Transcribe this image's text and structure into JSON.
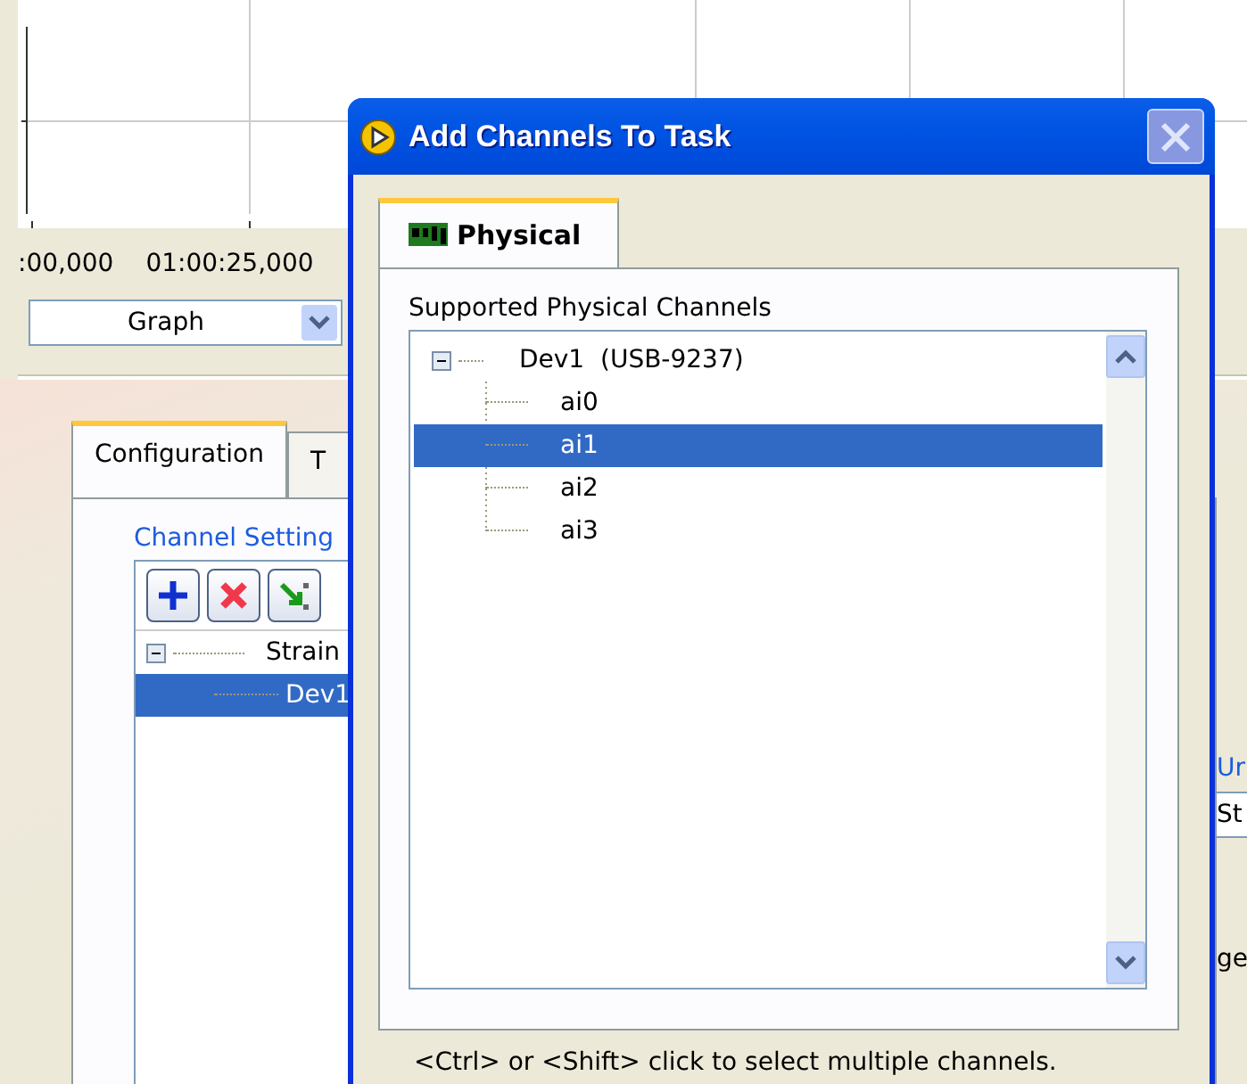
{
  "graph": {
    "x_tick_labels": [
      ":00,000",
      "01:00:25,000"
    ],
    "view_select": {
      "value": "Graph"
    }
  },
  "config_panel": {
    "tabs": [
      {
        "label": "Configuration",
        "selected": true
      },
      {
        "label": "T",
        "selected": false
      }
    ],
    "group_title": "Channel Setting",
    "tree": [
      {
        "label": "Strain",
        "expanded": true,
        "selected": false,
        "children": [
          {
            "label": "Dev1",
            "selected": true
          }
        ]
      }
    ]
  },
  "right_panel": {
    "column_header": "Ur",
    "cell": "St",
    "label": "ge"
  },
  "dialog": {
    "title": "Add Channels To Task",
    "tabs": [
      {
        "label": "Physical",
        "selected": true
      }
    ],
    "list_label": "Supported Physical Channels",
    "tree": [
      {
        "label": "Dev1  (USB-9237)",
        "expanded": true,
        "selected": false,
        "children": [
          {
            "label": "ai0",
            "selected": false
          },
          {
            "label": "ai1",
            "selected": true
          },
          {
            "label": "ai2",
            "selected": false
          },
          {
            "label": "ai3",
            "selected": false
          }
        ]
      }
    ],
    "hint": "<Ctrl> or <Shift> click to select multiple channels."
  }
}
